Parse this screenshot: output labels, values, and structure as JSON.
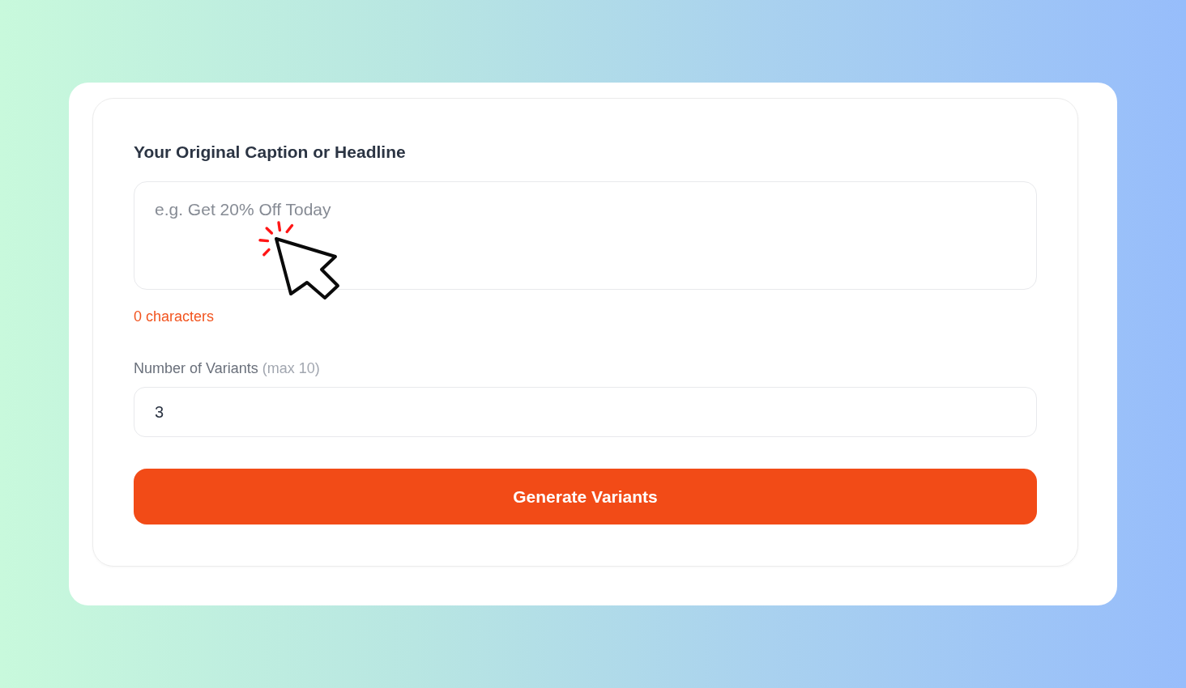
{
  "form": {
    "caption_field": {
      "label": "Your Original Caption or Headline",
      "placeholder": "e.g. Get 20% Off Today"
    },
    "character_count": "0 characters",
    "variants_field": {
      "label": "Number of Variants",
      "hint": "(max 10)",
      "value": "3"
    },
    "submit_button": {
      "label": "Generate Variants"
    }
  }
}
